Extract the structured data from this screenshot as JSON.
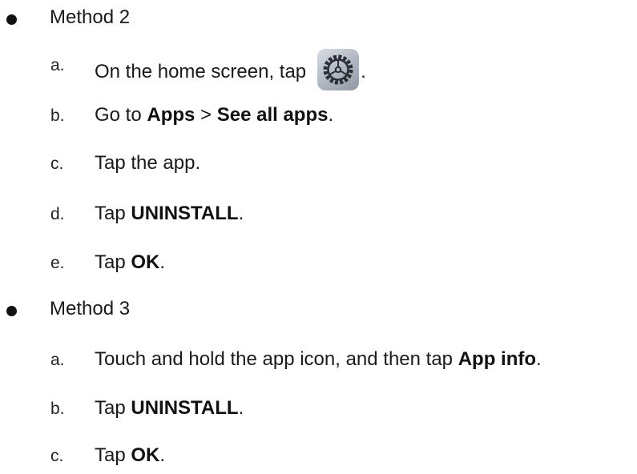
{
  "method2": {
    "label": "Method 2",
    "steps": {
      "a": {
        "letter": "a.",
        "text": "On the home screen, tap",
        "after": "."
      },
      "b": {
        "letter": "b.",
        "pre": "Go to ",
        "bold1": "Apps",
        "mid": " > ",
        "bold2": "See all apps",
        "post": "."
      },
      "c": {
        "letter": "c.",
        "text": "Tap the app."
      },
      "d": {
        "letter": "d.",
        "pre": "Tap ",
        "bold": "UNINSTALL",
        "post": "."
      },
      "e": {
        "letter": "e.",
        "pre": "Tap ",
        "bold": "OK",
        "post": "."
      }
    }
  },
  "method3": {
    "label": "Method 3",
    "steps": {
      "a": {
        "letter": "a.",
        "pre": "Touch and hold the app icon, and then tap ",
        "bold": "App info",
        "post": "."
      },
      "b": {
        "letter": "b.",
        "pre": "Tap ",
        "bold": "UNINSTALL",
        "post": "."
      },
      "c": {
        "letter": "c.",
        "pre": "Tap ",
        "bold": "OK",
        "post": "."
      }
    }
  },
  "icons": {
    "settings": "settings-gear-icon"
  }
}
